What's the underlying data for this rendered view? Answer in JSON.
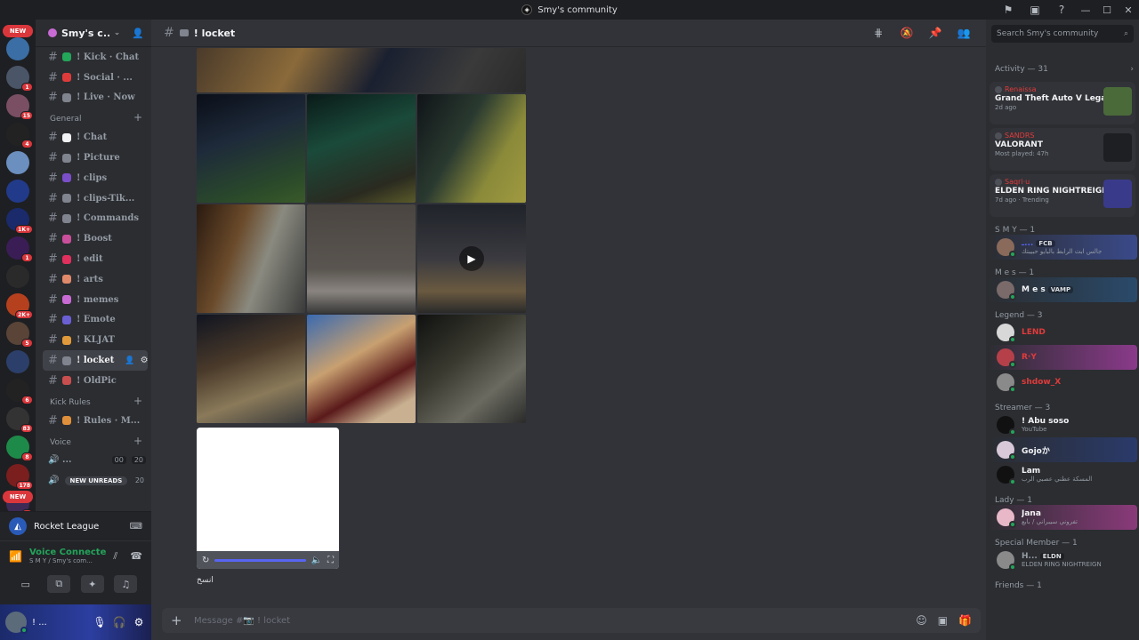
{
  "window": {
    "title": "Smy's community"
  },
  "rail": {
    "new_top": "NEW",
    "new_bottom": "NEW",
    "servers": [
      {
        "badge": "",
        "color": "#3a6ea5"
      },
      {
        "badge": "1",
        "color": "#4a5568"
      },
      {
        "badge": "15",
        "color": "#7a4f63"
      },
      {
        "badge": "4",
        "color": "#222"
      },
      {
        "badge": "",
        "color": "#6b8fbf"
      },
      {
        "badge": "",
        "color": "#223a8a"
      },
      {
        "badge": "1K+",
        "color": "#1a2a6a"
      },
      {
        "badge": "1",
        "color": "#3b1d55"
      },
      {
        "badge": "",
        "color": "#2a2a2a"
      },
      {
        "badge": "2K+",
        "color": "#b5401e"
      },
      {
        "badge": "5",
        "color": "#5a4438"
      },
      {
        "badge": "",
        "color": "#2c3f6a"
      },
      {
        "badge": "6",
        "color": "#222"
      },
      {
        "badge": "83",
        "color": "#333"
      },
      {
        "badge": "8",
        "color": "#1e8a4a"
      },
      {
        "badge": "178",
        "color": "#7a1e1e"
      },
      {
        "badge": "3",
        "color": "#3d2a55"
      }
    ]
  },
  "sidebar": {
    "guild_name": "Smy's c...",
    "channels_top": [
      {
        "name": "! Kick · Chat",
        "color": "#23a55a"
      },
      {
        "name": "! Social · ...",
        "color": "#e03b3b"
      },
      {
        "name": "! Live · Now",
        "color": "#80848e"
      }
    ],
    "category_general": "General",
    "channels_general": [
      {
        "name": "! Chat",
        "color": "#f2f3f5"
      },
      {
        "name": "! Picture",
        "color": "#80848e"
      },
      {
        "name": "! clips",
        "color": "#7b4fc9"
      },
      {
        "name": "! clips-Tik...",
        "color": "#80848e"
      },
      {
        "name": "! Commands",
        "color": "#80848e"
      },
      {
        "name": "! Boost",
        "color": "#c94f9a"
      },
      {
        "name": "! edit",
        "color": "#e0305e"
      },
      {
        "name": "! arts",
        "color": "#e08a6b"
      },
      {
        "name": "! memes",
        "color": "#c96bd4"
      },
      {
        "name": "! Emote",
        "color": "#6b5fd4"
      },
      {
        "name": "! KLJAT",
        "color": "#e09a3b"
      },
      {
        "name": "! locket",
        "color": "#80848e",
        "active": true
      },
      {
        "name": "! OldPic",
        "color": "#c94f4f"
      }
    ],
    "category_kick": "Kick Rules",
    "channels_kick": [
      {
        "name": "! Rules · M...",
        "color": "#e0903b"
      }
    ],
    "category_voice": "Voice",
    "voice_channel": {
      "name": "...",
      "count_a": "00",
      "count_b": "20"
    },
    "new_unreads": "NEW UNREADS",
    "new_unreads_count": "20"
  },
  "rl": {
    "name": "Rocket League"
  },
  "voice": {
    "title": "Voice Connecte",
    "sub": "S M Y / Smy's com..."
  },
  "user": {
    "name": "! ..."
  },
  "main": {
    "channel_name": "! locket",
    "caption": "انسخ",
    "composer_placeholder": "Message #📷 ! locket"
  },
  "members": {
    "search_placeholder": "Search Smy's community",
    "activity_header": "Activity — 31",
    "activities": [
      {
        "user": "Renaissa",
        "game": "Grand Theft Auto V Legacy",
        "meta": "2d ago",
        "color": "#4a6a3a"
      },
      {
        "user": "SANDRS",
        "game": "VALORANT",
        "meta": "Most played: 47h",
        "color": "#1e1f22"
      },
      {
        "user": "Saqri·u",
        "game": "ELDEN RING NIGHTREIGN",
        "meta": "7d ago  ·  Trending",
        "color": "#3a3a8a"
      }
    ],
    "groups": [
      {
        "role": "S M Y — 1",
        "members": [
          {
            "name": "ـ...",
            "sub": "جالس ابث الرابط بالبايو حبيبتك",
            "tag": "FCB",
            "color": "#5865f2",
            "avatar": "#8a6a5a",
            "bg": "linear-gradient(90deg,#2b2d31,#3a4a8a)"
          }
        ]
      },
      {
        "role": "M e s — 1",
        "members": [
          {
            "name": "M e s",
            "sub": "",
            "tag": "VAMP",
            "color": "#f2f3f5",
            "avatar": "#7a6a6a",
            "bg": "linear-gradient(90deg,#2b2d31,#2a4a6a)"
          }
        ]
      },
      {
        "role": "Legend — 3",
        "members": [
          {
            "name": "LEND",
            "sub": "",
            "tag": "",
            "color": "#e03b3b",
            "avatar": "#d8d8d8",
            "bg": "none"
          },
          {
            "name": "R·Y",
            "sub": "",
            "tag": "",
            "color": "#e03b3b",
            "avatar": "#b5404a",
            "bg": "linear-gradient(90deg,#2b2d31,#8a3a8a)"
          },
          {
            "name": "shdow_X",
            "sub": "",
            "tag": "",
            "color": "#e03b3b",
            "avatar": "#8a8a8a",
            "bg": "none"
          }
        ]
      },
      {
        "role": "Streamer — 3",
        "members": [
          {
            "name": "! Abu soso",
            "sub": "YouTube",
            "tag": "",
            "color": "#f2f3f5",
            "avatar": "#111",
            "bg": "none"
          },
          {
            "name": "Gojoか",
            "sub": "",
            "tag": "",
            "color": "#f2f3f5",
            "avatar": "#d8c8d8",
            "bg": "linear-gradient(90deg,#2b2d31,#2a3a6a)"
          },
          {
            "name": "Lam",
            "sub": "المسكة عطني عصبي الرب",
            "tag": "",
            "color": "#f2f3f5",
            "avatar": "#111",
            "bg": "none"
          }
        ]
      },
      {
        "role": "Lady — 1",
        "members": [
          {
            "name": "Jana",
            "sub": "تفروني سيبراني / بابع",
            "tag": "",
            "color": "#f2f3f5",
            "avatar": "#e8b8c8",
            "bg": "linear-gradient(90deg,#2b2d31,#8a3a7a)"
          }
        ]
      },
      {
        "role": "Special Member — 1",
        "members": [
          {
            "name": "H...",
            "sub": "ELDEN RING NIGHTREIGN",
            "tag": "ELDN",
            "color": "#949ba4",
            "avatar": "#8a8a8a",
            "bg": "none"
          }
        ]
      },
      {
        "role": "Friends — 1",
        "members": []
      }
    ]
  },
  "colors": {
    "accent": "#5865f2",
    "online": "#23a55a",
    "danger": "#da373c"
  }
}
